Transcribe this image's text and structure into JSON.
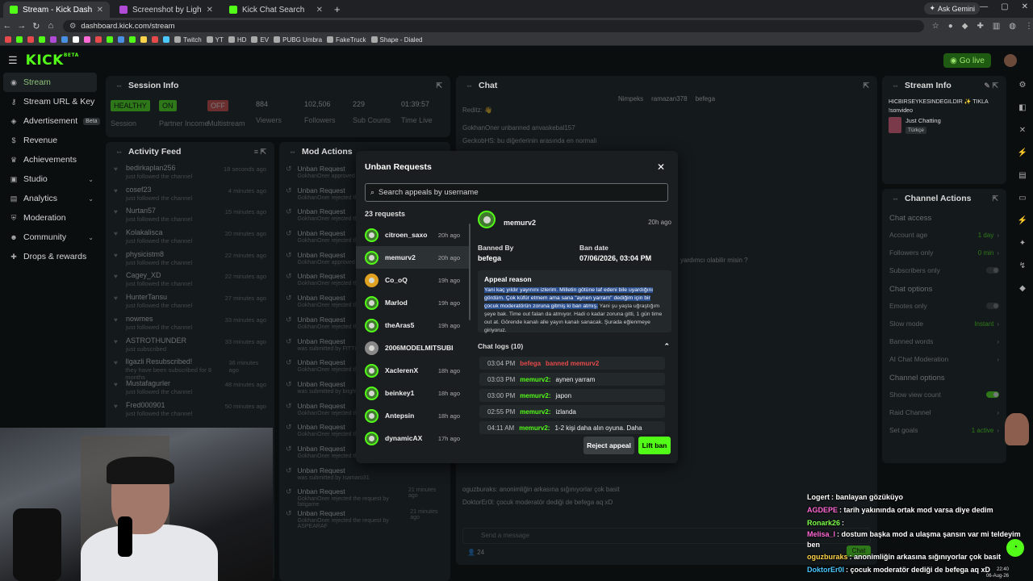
{
  "browser": {
    "tabs": [
      {
        "title": "Stream - Kick Dashboard",
        "color": "#53fc18",
        "active": true
      },
      {
        "title": "Screenshot by Lightshot",
        "color": "#b04bd6",
        "active": false
      },
      {
        "title": "Kick Chat Search",
        "color": "#53fc18",
        "active": false
      }
    ],
    "new_tab": "+",
    "ask_gemini": "Ask Gemini",
    "url": "dashboard.kick.com/stream",
    "bookmarks": [
      "Twitch",
      "YT",
      "HD",
      "EV",
      "PUBG Umbra",
      "FakeTruck",
      "Shape - Dialed"
    ]
  },
  "app": {
    "logo": "KICK",
    "logo_badge": "BETA",
    "go_live": "Go live"
  },
  "sidebar": {
    "items": [
      {
        "label": "Stream",
        "icon": "broadcast-icon",
        "active": true
      },
      {
        "label": "Stream URL & Key",
        "icon": "key-icon"
      },
      {
        "label": "Advertisement",
        "icon": "megaphone-icon",
        "badge": "Beta"
      },
      {
        "label": "Revenue",
        "icon": "dollar-icon"
      },
      {
        "label": "Achievements",
        "icon": "trophy-icon"
      },
      {
        "label": "Studio",
        "icon": "studio-icon",
        "expandable": true
      },
      {
        "label": "Analytics",
        "icon": "chart-icon",
        "expandable": true
      },
      {
        "label": "Moderation",
        "icon": "shield-icon"
      },
      {
        "label": "Community",
        "icon": "users-icon",
        "expandable": true
      },
      {
        "label": "Drops & rewards",
        "icon": "gift-icon"
      }
    ]
  },
  "session": {
    "title": "Session Info",
    "stats": [
      {
        "value": "HEALTHY",
        "label": "Session",
        "pill_color": "#53fc18"
      },
      {
        "value": "ON",
        "label": "Partner Income",
        "pill_color": "#53fc18"
      },
      {
        "value": "OFF",
        "label": "Multistream",
        "pill_color": "#e64a4a"
      },
      {
        "value": "884",
        "label": "Viewers"
      },
      {
        "value": "102,506",
        "label": "Followers"
      },
      {
        "value": "229",
        "label": "Sub Counts"
      },
      {
        "value": "01:39:57",
        "label": "Time Live"
      }
    ]
  },
  "activity": {
    "title": "Activity Feed",
    "rows": [
      {
        "name": "bedirkaplan256",
        "sub": "just followed the channel",
        "time": "18 seconds ago"
      },
      {
        "name": "cosef23",
        "sub": "just followed the channel",
        "time": "4 minutes ago"
      },
      {
        "name": "Nurtan57",
        "sub": "just followed the channel",
        "time": "15 minutes ago"
      },
      {
        "name": "Kolakalisca",
        "sub": "just followed the channel",
        "time": "20 minutes ago"
      },
      {
        "name": "physicistm8",
        "sub": "just followed the channel",
        "time": "22 minutes ago"
      },
      {
        "name": "Cagey_XD",
        "sub": "just followed the channel",
        "time": "22 minutes ago"
      },
      {
        "name": "HunterTansu",
        "sub": "just followed the channel",
        "time": "27 minutes ago"
      },
      {
        "name": "nowmes",
        "sub": "just followed the channel",
        "time": "33 minutes ago"
      },
      {
        "name": "ASTROTHUNDER",
        "sub": "just subscribed",
        "time": "33 minutes ago"
      },
      {
        "name": "Ilgazli Resubscribed!",
        "sub": "they have been subscribed for 8 months",
        "time": "36 minutes ago"
      },
      {
        "name": "Mustafagurler",
        "sub": "just followed the channel",
        "time": "48 minutes ago"
      },
      {
        "name": "Fred000901",
        "sub": "just followed the channel",
        "time": "50 minutes ago"
      }
    ]
  },
  "mod_actions": {
    "title": "Mod Actions",
    "rows": [
      {
        "name": "Unban Request",
        "sub": "GokhanOner approved the request",
        "time": ""
      },
      {
        "name": "Unban Request",
        "sub": "GokhanOner rejected the request",
        "time": ""
      },
      {
        "name": "Unban Request",
        "sub": "GokhanOner rejected the request",
        "time": ""
      },
      {
        "name": "Unban Request",
        "sub": "GokhanOner rejected the request",
        "time": ""
      },
      {
        "name": "Unban Request",
        "sub": "GokhanOner approved the request",
        "time": ""
      },
      {
        "name": "Unban Request",
        "sub": "GokhanOner rejected the request",
        "time": ""
      },
      {
        "name": "Unban Request",
        "sub": "GokhanOner rejected the request",
        "time": ""
      },
      {
        "name": "Unban Request",
        "sub": "GokhanOner rejected the request",
        "time": ""
      },
      {
        "name": "Unban Request",
        "sub": "was submitted by FITTI",
        "time": ""
      },
      {
        "name": "Unban Request",
        "sub": "GokhanOner rejected the request",
        "time": ""
      },
      {
        "name": "Unban Request",
        "sub": "was submitted by bright",
        "time": ""
      },
      {
        "name": "Unban Request",
        "sub": "GokhanOner rejected the request",
        "time": ""
      },
      {
        "name": "Unban Request",
        "sub": "GokhanOner rejected the request",
        "time": ""
      },
      {
        "name": "Unban Request",
        "sub": "GokhanOner rejected the request by DgnCan55",
        "time": ""
      },
      {
        "name": "Unban Request",
        "sub": "was submitted by Isamaro31",
        "time": ""
      },
      {
        "name": "Unban Request",
        "sub": "GokhanOner rejected the request by fatigame",
        "time": "21 minutes ago"
      },
      {
        "name": "Unban Request",
        "sub": "GokhanOner rejected the request by ASPEARAF",
        "time": "21 minutes ago"
      }
    ]
  },
  "chat": {
    "title": "Chat",
    "top_users": [
      "Nimpeks",
      "ramazan378",
      "befega"
    ],
    "messages": [
      "Reditz: 👋",
      "GokhanOner unbanned anvaskebal157",
      "GeckobHS: bu diğerlerinin arasında en normali",
      "yardımcı olabilir misin ?",
      "oguzburaks: anonimliğin arkasına sığınıyorlar çok basit",
      "DoktorEr0l: çocuk moderatör dediği de befega aq xD"
    ],
    "placeholder": "Send a message",
    "viewer_count": "24",
    "send_label": "Chat"
  },
  "stream_info": {
    "title": "Stream Info",
    "stream_title": "HICBIRSEYKESINDEGILDIR ✨ TIKLA",
    "subtitle": "!sonvideo",
    "category": "Just Chatting",
    "tag": "Türkçe"
  },
  "channel_actions": {
    "title": "Channel Actions",
    "sections": [
      {
        "title": "Chat access",
        "rows": [
          {
            "label": "Account age",
            "value": "1 day",
            "kind": "value"
          },
          {
            "label": "Followers only",
            "value": "0 min",
            "kind": "value"
          },
          {
            "label": "Subscribers only",
            "value": "",
            "kind": "toggle",
            "on": false
          }
        ]
      },
      {
        "title": "Chat options",
        "rows": [
          {
            "label": "Emotes only",
            "value": "",
            "kind": "toggle",
            "on": false
          },
          {
            "label": "Slow mode",
            "value": "Instant",
            "kind": "value"
          },
          {
            "label": "Banned words",
            "value": "",
            "kind": "link"
          },
          {
            "label": "AI Chat Moderation",
            "value": "",
            "kind": "link"
          }
        ]
      },
      {
        "title": "Channel options",
        "rows": [
          {
            "label": "Show view count",
            "value": "",
            "kind": "toggle",
            "on": true
          },
          {
            "label": "Raid Channel",
            "value": "",
            "kind": "link"
          },
          {
            "label": "Set goals",
            "value": "1 active",
            "kind": "value"
          }
        ]
      }
    ]
  },
  "modal": {
    "title": "Unban Requests",
    "search_placeholder": "Search appeals by username",
    "count": "23 requests",
    "requests": [
      {
        "name": "citroen_saxo",
        "time": "20h ago",
        "selected": false
      },
      {
        "name": "memurv2",
        "time": "20h ago",
        "selected": true
      },
      {
        "name": "Co_oQ",
        "time": "19h ago",
        "selected": false
      },
      {
        "name": "Marlod",
        "time": "19h ago",
        "selected": false
      },
      {
        "name": "theAras5",
        "time": "19h ago",
        "selected": false
      },
      {
        "name": "2006MODELMITSUBISHI",
        "time": "",
        "selected": false
      },
      {
        "name": "XaclerenX",
        "time": "18h ago",
        "selected": false
      },
      {
        "name": "beinkey1",
        "time": "18h ago",
        "selected": false
      },
      {
        "name": "Antepsin",
        "time": "18h ago",
        "selected": false
      },
      {
        "name": "dynamicAX",
        "time": "17h ago",
        "selected": false
      }
    ],
    "detail": {
      "user": "memurv2",
      "time": "20h ago",
      "banned_by_label": "Banned By",
      "banned_by": "befega",
      "ban_date_label": "Ban date",
      "ban_date": "07/06/2026, 03:04 PM",
      "appeal_label": "Appeal reason",
      "appeal_highlight": "Yani kaç yıldır yayınını izlerim. Milletin götüne laf edeni bile uyardığını gördüm. Çok küfür etmem ama sana \"aynen yarram\" dediğim için bir çocuk moderatörün zoruna gitmiş ki ban atmış.",
      "appeal_rest": " Yani şu yaşta uğraştığım şeye bak. Time out falan da atmıyor. Hadi o kadar zoruna gitti, 1 gün time out at. Görende kanalı alle yayın kanalı sanacak. Şurada eğlenmeye giriyoruz.",
      "logs_label": "Chat logs (10)",
      "logs": [
        {
          "time": "03:04 PM",
          "user": "befega",
          "text": "banned memurv2",
          "type": "ban"
        },
        {
          "time": "03:03 PM",
          "user": "memurv2:",
          "text": "aynen yarram",
          "type": "msg"
        },
        {
          "time": "03:00 PM",
          "user": "memurv2:",
          "text": "japon",
          "type": "msg"
        },
        {
          "time": "02:55 PM",
          "user": "memurv2:",
          "text": "izlanda",
          "type": "msg"
        },
        {
          "time": "04:11 AM",
          "user": "memurv2:",
          "text": "1-2 kişi daha alın oyuna. Daha",
          "type": "msg"
        }
      ]
    },
    "reject_label": "Reject appeal",
    "lift_label": "Lift ban"
  },
  "overlay": {
    "lines": [
      {
        "user": "Logert",
        "color": "#ffffff",
        "text": ": banlayan gözüküyo"
      },
      {
        "user": "AGDEPE",
        "color": "#ff6ad5",
        "text": ": tarih yakınında ortak mod varsa diye dedim"
      },
      {
        "user": "Ronark26",
        "color": "#7cff4a",
        "text": ":"
      },
      {
        "user": "Melisa_l",
        "color": "#ff6ad5",
        "text": ": dostum başka mod a ulaşma şansın var mi teldeyim ben"
      },
      {
        "user": "oguzburaks",
        "color": "#ffd34a",
        "text": ": anonimliğin arkasına sığınıyorlar çok basit"
      },
      {
        "user": "DoktorEr0l",
        "color": "#4ac8ff",
        "text": ": çocuk moderatör dediği de befega aq xD"
      }
    ]
  },
  "taskbar": {
    "time": "22:40",
    "date": "06-Aug-26"
  },
  "colors": {
    "brand": "#53fc18",
    "danger": "#e64a4a",
    "panel": "#14191b",
    "modal": "#1a1e20"
  }
}
